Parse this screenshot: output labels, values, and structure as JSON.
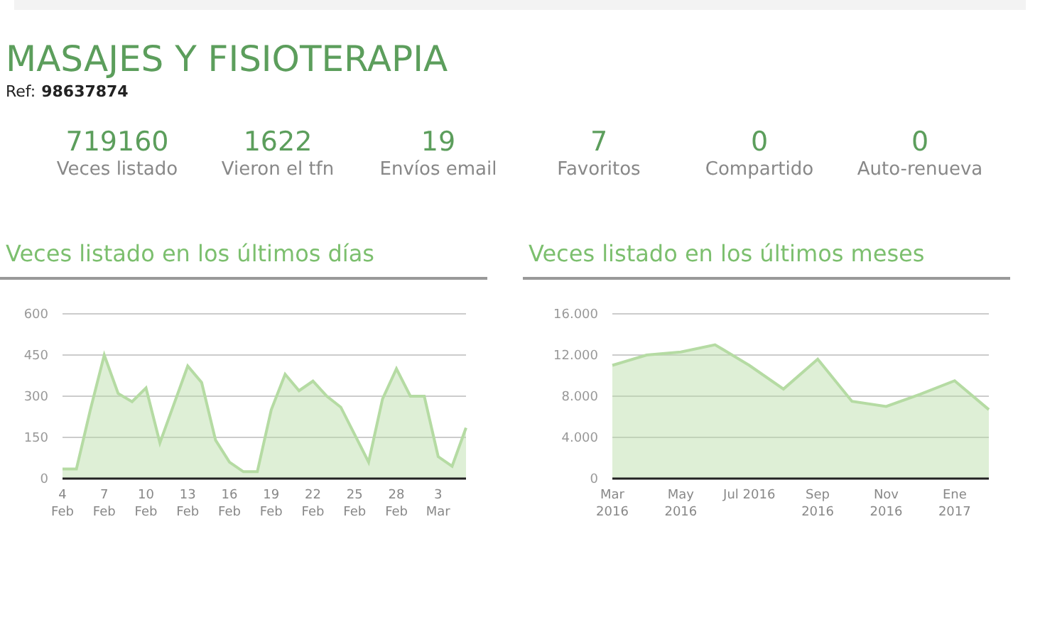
{
  "title": "MASAJES Y FISIOTERAPIA",
  "ref": {
    "label": "Ref:",
    "value": "98637874"
  },
  "stats": [
    {
      "value": "719160",
      "label": "Veces listado"
    },
    {
      "value": "1622",
      "label": "Vieron el tfn"
    },
    {
      "value": "19",
      "label": "Envíos email"
    },
    {
      "value": "7",
      "label": "Favoritos"
    },
    {
      "value": "0",
      "label": "Compartido"
    },
    {
      "value": "0",
      "label": "Auto-renueva"
    }
  ],
  "charts": [
    {
      "heading": "Veces listado en los últimos días",
      "chart_data": {
        "type": "area",
        "categories": [
          "4\nFeb",
          null,
          null,
          "7\nFeb",
          null,
          null,
          "10\nFeb",
          null,
          null,
          "13\nFeb",
          null,
          null,
          "16\nFeb",
          null,
          null,
          "19\nFeb",
          null,
          null,
          "22\nFeb",
          null,
          null,
          "25\nFeb",
          null,
          null,
          "28\nFeb",
          null,
          null,
          "3\nMar",
          null,
          null
        ],
        "series": [
          {
            "color": "#b5dba3",
            "values": [
              35,
              35,
              250,
              450,
              310,
              280,
              330,
              130,
              270,
              410,
              350,
              140,
              60,
              25,
              25,
              250,
              380,
              320,
              355,
              300,
              260,
              160,
              60,
              290,
              400,
              300,
              300,
              80,
              45,
              185
            ]
          }
        ],
        "ylim": [
          0,
          600
        ],
        "yticks": [
          0,
          150,
          300,
          450,
          600
        ],
        "grid": true
      }
    },
    {
      "heading": "Veces listado en los últimos meses",
      "chart_data": {
        "type": "area",
        "categories": [
          "Mar\n2016",
          null,
          "May\n2016",
          null,
          "Jul 2016",
          null,
          "Sep\n2016",
          null,
          "Nov\n2016",
          null,
          "Ene\n2017",
          null
        ],
        "series": [
          {
            "color": "#b5dba3",
            "values": [
              11000,
              12000,
              12300,
              13000,
              11000,
              8700,
              11600,
              7500,
              7000,
              8200,
              9500,
              6700
            ]
          }
        ],
        "ylim": [
          0,
          16000
        ],
        "yticks": [
          {
            "value": 0,
            "label": "0"
          },
          {
            "value": 4000,
            "label": "4.000"
          },
          {
            "value": 8000,
            "label": "8.000"
          },
          {
            "value": 12000,
            "label": "12.000"
          },
          {
            "value": 16000,
            "label": "16.000"
          }
        ],
        "grid": true
      }
    }
  ]
}
